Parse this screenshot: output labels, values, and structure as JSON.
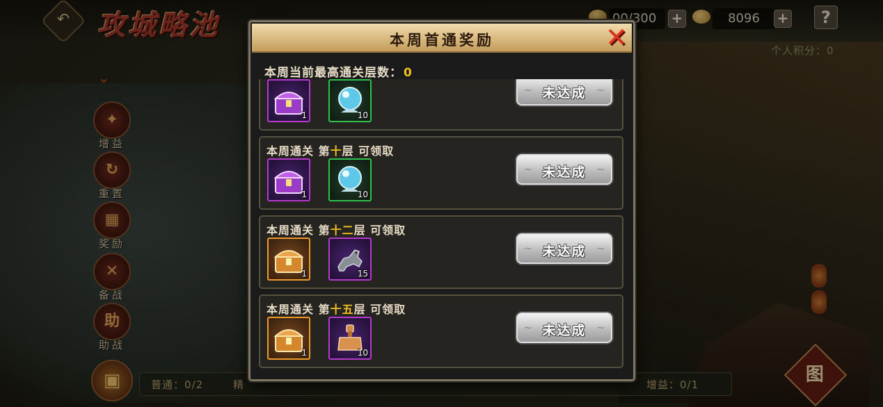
{
  "top_bar": {
    "title": "攻城略池",
    "stamina": "00/300",
    "gold": "8096",
    "help": "?"
  },
  "personal_score": "个人积分：0",
  "left_menu": [
    {
      "label": "增益",
      "icon": "buff-icon",
      "glyph": "✦"
    },
    {
      "label": "重置",
      "icon": "reset-icon",
      "glyph": "↻"
    },
    {
      "label": "奖励",
      "icon": "reward-box-icon",
      "glyph": "▦"
    },
    {
      "label": "备战",
      "icon": "crossed-swords-icon",
      "glyph": "✕"
    },
    {
      "label": "助战",
      "icon": "assist-icon",
      "glyph": "助"
    }
  ],
  "bottom_stats": {
    "normal": "普通：0/2",
    "elite": "精",
    "buff": "增益：0/1"
  },
  "map_button": "图",
  "modal": {
    "title": "本周首通奖励",
    "floor_label": "本周当前最高通关层数：",
    "floor_value": "0",
    "rows": [
      {
        "prefix": "",
        "floor": "",
        "suffix": "",
        "items": [
          {
            "icon": "purple-chest-icon",
            "rarity": "purple",
            "count": "1"
          },
          {
            "icon": "blue-orb-icon",
            "rarity": "green",
            "count": "10"
          }
        ],
        "status": "未达成"
      },
      {
        "prefix": "本周通关 第",
        "floor": "十",
        "suffix": "层 可领取",
        "items": [
          {
            "icon": "purple-chest-icon",
            "rarity": "purple",
            "count": "1"
          },
          {
            "icon": "blue-orb-icon",
            "rarity": "green",
            "count": "10"
          }
        ],
        "status": "未达成"
      },
      {
        "prefix": "本周通关 第",
        "floor": "十二",
        "suffix": "层 可领取",
        "items": [
          {
            "icon": "gold-chest-icon",
            "rarity": "orange",
            "count": "1"
          },
          {
            "icon": "iron-horse-icon",
            "rarity": "purple",
            "count": "15"
          }
        ],
        "status": "未达成"
      },
      {
        "prefix": "本周通关 第",
        "floor": "十五",
        "suffix": "层 可领取",
        "items": [
          {
            "icon": "gold-chest-icon",
            "rarity": "orange",
            "count": "1"
          },
          {
            "icon": "bronze-seal-icon",
            "rarity": "purple",
            "count": "10"
          }
        ],
        "status": "未达成"
      }
    ]
  },
  "colors": {
    "floor_highlight": "#f2c11f",
    "header": "#d9b97f",
    "close": "#d8331c"
  }
}
